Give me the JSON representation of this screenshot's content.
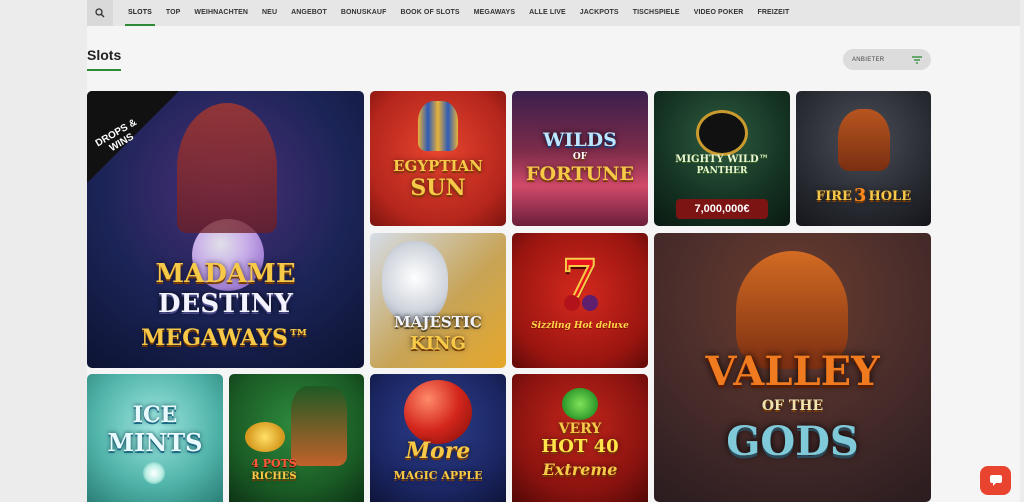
{
  "nav": {
    "search_icon": "search-icon",
    "items": [
      "SLOTS",
      "TOP",
      "WEIHNACHTEN",
      "NEU",
      "ANGEBOT",
      "BONUSKAUF",
      "BOOK OF SLOTS",
      "MEGAWAYS",
      "ALLE LIVE",
      "JACKPOTS",
      "TISCHSPIELE",
      "VIDEO POKER",
      "FREIZEIT"
    ],
    "active": "SLOTS"
  },
  "page": {
    "title": "Slots"
  },
  "filter": {
    "label": "ANBIETER",
    "icon": "filter-icon"
  },
  "games": {
    "madame_destiny": {
      "line1": "MADAME",
      "line2": "DESTINY",
      "line3": "MEGAWAYS™",
      "badge": "DROPS & WINS"
    },
    "egyptian_sun": {
      "line1": "EGYPTIAN",
      "line2": "SUN"
    },
    "wilds_of_fortune": {
      "line1": "WILDS",
      "line2": "OF",
      "line3": "FORTUNE"
    },
    "mighty_wild_panther": {
      "line1": "MIGHTY WILD™",
      "line2": "PANTHER",
      "jackpot": "7,000,000€"
    },
    "fire_in_the_hole": {
      "line1": "FIRE",
      "line2": "3",
      "line3": "HOLE"
    },
    "majestic_king": {
      "line1": "MAJESTIC",
      "line2": "KING"
    },
    "sizzling_hot": {
      "line1": "7",
      "line2": "Sizzling Hot deluxe"
    },
    "valley_of_the_gods": {
      "line1": "VALLEY",
      "line2": "OF THE",
      "line3": "GODS"
    },
    "ice_mints": {
      "line1": "ICE",
      "line2": "MINTS"
    },
    "pots_of_riches": {
      "line1": "4 POTS",
      "line2": "RICHES"
    },
    "more_magic_apple": {
      "line1": "More",
      "line2": "MAGIC APPLE"
    },
    "very_hot_40": {
      "line1": "VERY",
      "line2": "HOT 40",
      "line3": "Extreme"
    }
  },
  "colors": {
    "accent": "#2e8a36",
    "chat": "#e8442f"
  }
}
